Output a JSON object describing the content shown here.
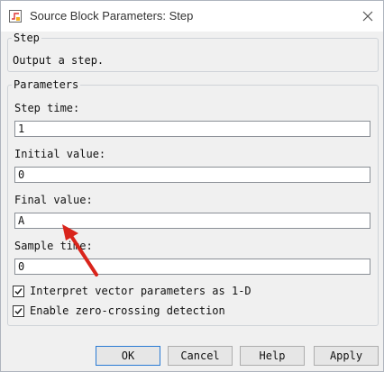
{
  "window": {
    "title": "Source Block Parameters: Step"
  },
  "description_group": {
    "legend": "Step",
    "text": "Output a step."
  },
  "parameters_group": {
    "legend": "Parameters",
    "fields": [
      {
        "label": "Step time:",
        "value": "1"
      },
      {
        "label": "Initial value:",
        "value": "0"
      },
      {
        "label": "Final value:",
        "value": "A"
      },
      {
        "label": "Sample time:",
        "value": "0"
      }
    ],
    "checkboxes": [
      {
        "label": "Interpret vector parameters as 1-D",
        "checked": true
      },
      {
        "label": "Enable zero-crossing detection",
        "checked": true
      }
    ]
  },
  "buttons": {
    "ok": "OK",
    "cancel": "Cancel",
    "help": "Help",
    "apply": "Apply"
  },
  "colors": {
    "annotation_arrow": "#d9241b",
    "default_button_border": "#2a7bd4"
  },
  "icons": {
    "app": "simulink-block-icon",
    "close": "close-icon"
  }
}
